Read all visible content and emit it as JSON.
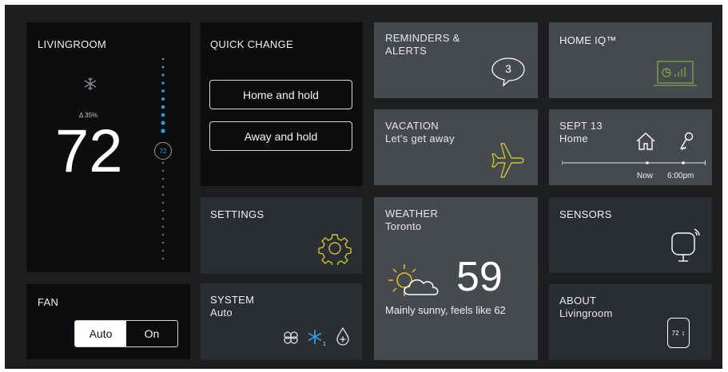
{
  "livingroom": {
    "title": "LIVINGROOM",
    "humidity": "Δ 35%",
    "temperature": "72",
    "setpoint": "72"
  },
  "fan": {
    "title": "FAN",
    "options": [
      "Auto",
      "On"
    ],
    "selected": "Auto"
  },
  "quick_change": {
    "title": "QUICK CHANGE",
    "buttons": [
      "Home and hold",
      "Away and hold"
    ]
  },
  "settings": {
    "title": "SETTINGS"
  },
  "system": {
    "title": "SYSTEM",
    "mode": "Auto"
  },
  "reminders": {
    "title_line1": "REMINDERS &",
    "title_line2": "ALERTS",
    "count": "3"
  },
  "vacation": {
    "title": "VACATION",
    "subtitle": "Let's get away"
  },
  "weather": {
    "title": "WEATHER",
    "city": "Toronto",
    "temperature": "59",
    "description": "Mainly sunny, feels like 62"
  },
  "home_iq": {
    "title": "HOME IQ™"
  },
  "schedule": {
    "date": "SEPT 13",
    "mode": "Home",
    "now_label": "Now",
    "time_label": "6:00pm"
  },
  "sensors": {
    "title": "SENSORS"
  },
  "about": {
    "title": "ABOUT",
    "subtitle": "Livingroom",
    "badge": "72"
  },
  "colors": {
    "accent_blue": "#2d9be0",
    "accent_yellow": "#c9c23a",
    "iq_green": "#7fa84b",
    "tile_dark": "#0c0d0f",
    "tile_gray": "#46494d"
  }
}
